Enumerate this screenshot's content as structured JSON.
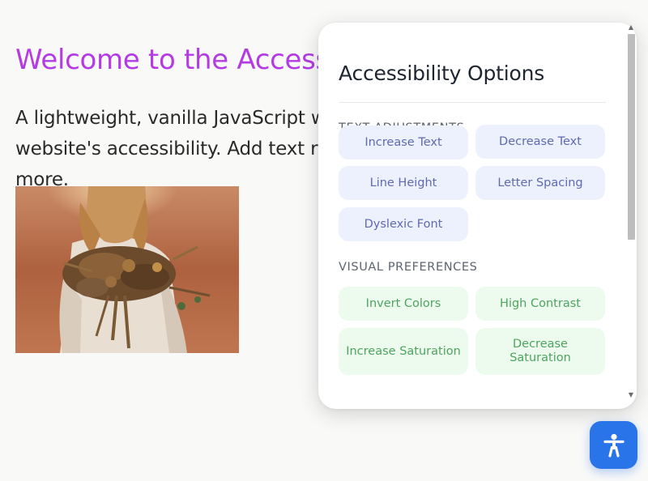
{
  "hero": {
    "title": "Welcome to the Accessibility",
    "text": "A lightweight, vanilla JavaScript widget that helps improve your website's accessibility. Add text resize, color adjustments, and more.",
    "image_icon": "photo-bride-bouquet"
  },
  "panel": {
    "title": "Accessibility Options",
    "sections": {
      "text_adjustments": {
        "heading": "TEXT ADJUSTMENTS",
        "buttons": [
          "Increase Text",
          "Decrease Text",
          "Line Height",
          "Letter Spacing",
          "Dyslexic Font"
        ]
      },
      "visual_preferences": {
        "heading": "VISUAL PREFERENCES",
        "buttons": [
          "Invert Colors",
          "High Contrast",
          "Increase Saturation",
          "Decrease Saturation"
        ]
      }
    },
    "scrollbar": {
      "up_icon": "triangle-up-icon",
      "down_icon": "triangle-down-icon"
    }
  },
  "fab": {
    "icon": "accessibility-person-icon"
  },
  "colors": {
    "title_accent": "#b43be3",
    "text_adjust_bg": "#ecf1fd",
    "text_adjust_fg": "#5f6ab0",
    "visual_bg": "#ecfbee",
    "visual_fg": "#4ea45f",
    "fab_bg": "#2a74ea"
  }
}
